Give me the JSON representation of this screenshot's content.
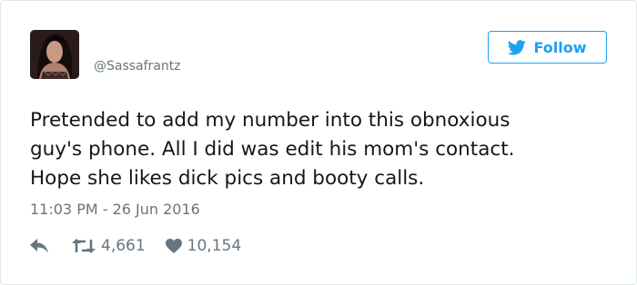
{
  "author": {
    "handle": "@Sassafrantz"
  },
  "follow_button": {
    "label": "Follow",
    "icon": "twitter-bird-icon"
  },
  "tweet": {
    "text": "Pretended to add my number into this obnoxious\nguy's phone. All I did was edit his mom's contact.\nHope she likes dick pics and booty calls.",
    "timestamp": "11:03 PM - 26 Jun 2016"
  },
  "actions": {
    "reply_icon": "reply-icon",
    "retweet_icon": "retweet-icon",
    "retweet_count": "4,661",
    "like_icon": "heart-icon",
    "like_count": "10,154"
  },
  "colors": {
    "accent": "#1da1f2",
    "text": "#14171a",
    "muted": "#66757f",
    "border": "#e1e8ed"
  }
}
